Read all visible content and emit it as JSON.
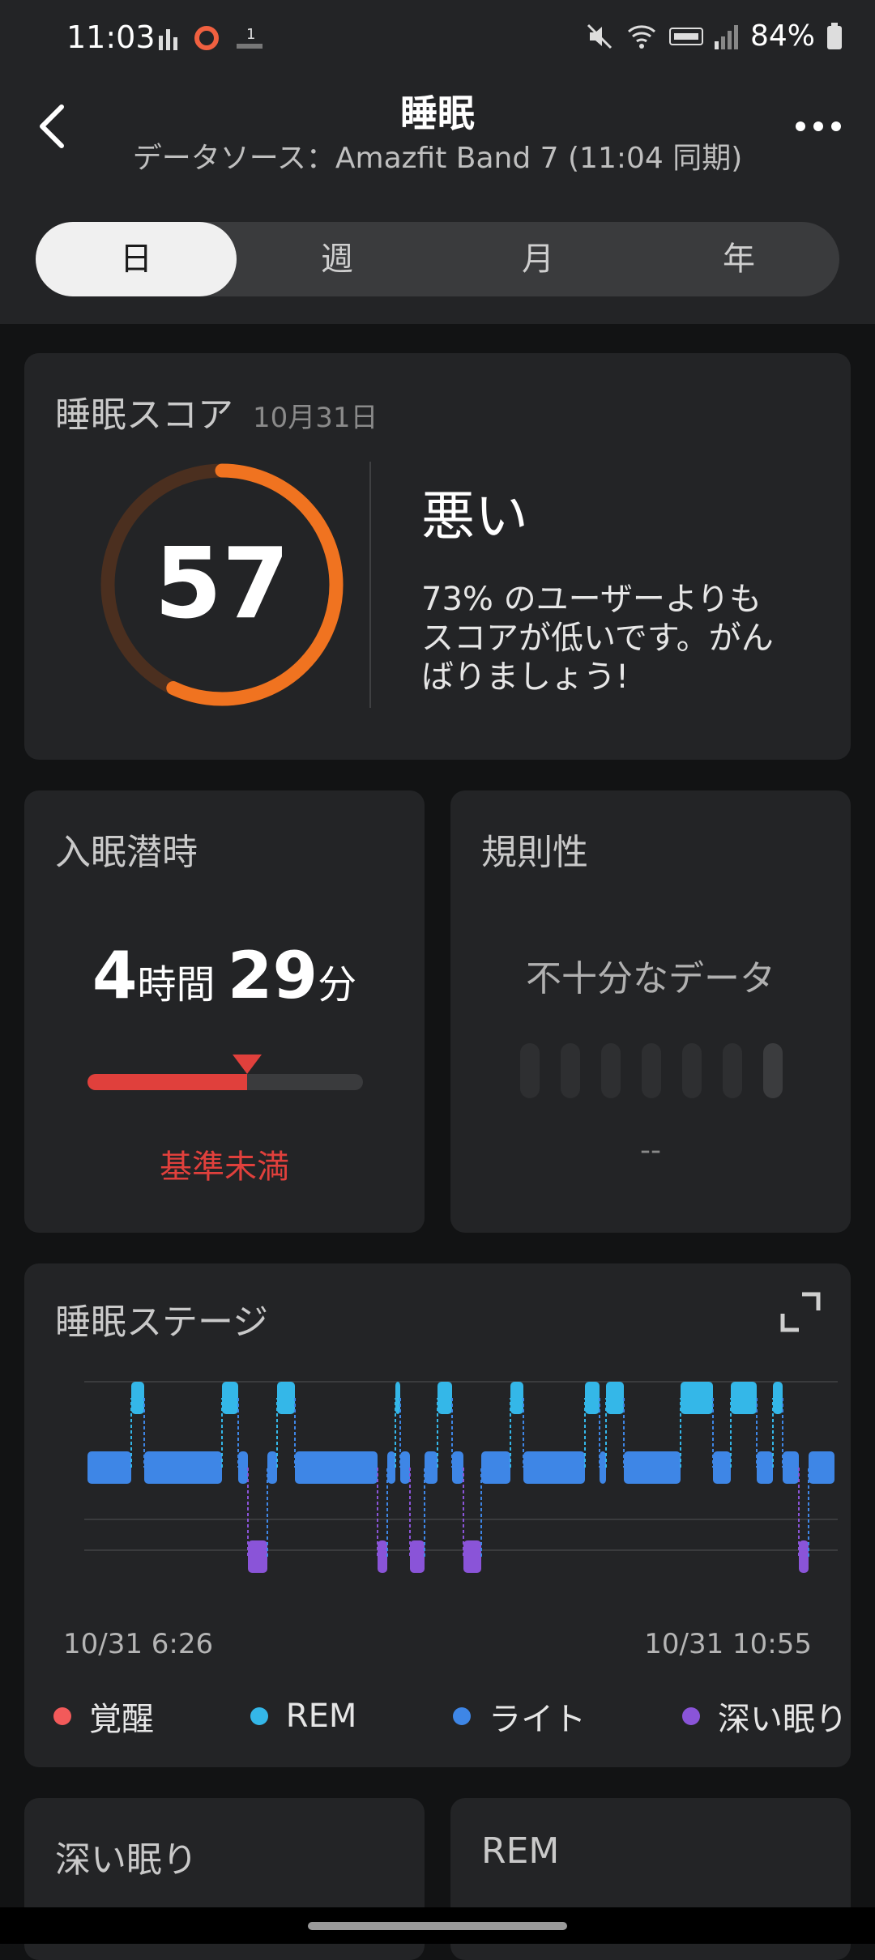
{
  "status_bar": {
    "time": "11:03",
    "battery": "84%"
  },
  "header": {
    "title": "睡眠",
    "subtitle": "データソース：Amazfit Band 7 (11:04 同期)"
  },
  "tabs": [
    {
      "label": "日",
      "active": true
    },
    {
      "label": "週",
      "active": false
    },
    {
      "label": "月",
      "active": false
    },
    {
      "label": "年",
      "active": false
    }
  ],
  "score_card": {
    "title": "睡眠スコア",
    "date": "10月31日",
    "score": "57",
    "score_fraction": 0.57,
    "rating": "悪い",
    "description": "73% のユーザーよりもスコアが低いです。がんばりましょう!"
  },
  "latency_card": {
    "title": "入眠潜時",
    "hours": "4",
    "hours_unit": "時間",
    "minutes": "29",
    "minutes_unit": "分",
    "level_fraction": 0.58,
    "status": "基準未満"
  },
  "regularity_card": {
    "title": "規則性",
    "message": "不十分なデータ",
    "value": "--"
  },
  "stages_card": {
    "title": "睡眠ステージ",
    "start_label": "10/31 6:26",
    "end_label": "10/31 10:55",
    "legend": [
      {
        "label": "覚醒",
        "color": "#f25a5a"
      },
      {
        "label": "REM",
        "color": "#34b7e8"
      },
      {
        "label": "ライト",
        "color": "#3e86e6"
      },
      {
        "label": "深い眠り",
        "color": "#8a54d8"
      }
    ]
  },
  "bottom_cards": {
    "left_title": "深い眠り",
    "right_title": "REM"
  },
  "colors": {
    "accent": "#f07320",
    "ring_track": "#4b2f1f",
    "warning": "#e0403c"
  }
}
